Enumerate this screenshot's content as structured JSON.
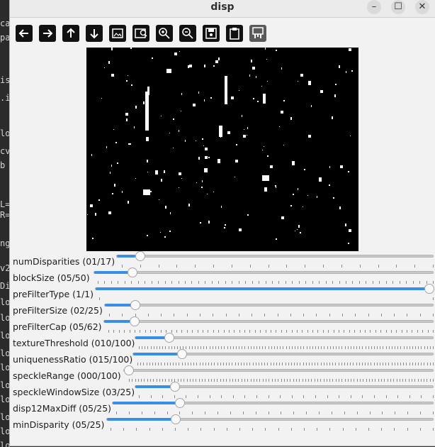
{
  "window": {
    "title": "disp",
    "minimize_glyph": "–",
    "maximize_glyph": "☐",
    "close_glyph": "✕"
  },
  "background_editor_fragments": [
    "ca",
    "pa",
    "",
    "is",
    ".i",
    "",
    "lo",
    "cv",
    " b",
    "",
    "",
    "L=",
    "R=",
    "",
    "ng",
    "",
    "v2",
    "Di",
    "lo",
    "lo",
    "lo",
    "lo",
    "lo",
    "lo",
    "lo",
    "lo",
    "lo",
    "lo"
  ],
  "toolbar": {
    "buttons": [
      {
        "name": "back-button",
        "icon": "arrow-left-icon"
      },
      {
        "name": "forward-button",
        "icon": "arrow-right-icon"
      },
      {
        "name": "up-button",
        "icon": "arrow-up-icon"
      },
      {
        "name": "down-button",
        "icon": "arrow-down-icon"
      },
      {
        "name": "image-button",
        "icon": "image-icon"
      },
      {
        "name": "image-zoom-button",
        "icon": "image-zoom-icon"
      },
      {
        "name": "zoom-in-button",
        "icon": "zoom-in-icon"
      },
      {
        "name": "zoom-out-button",
        "icon": "zoom-out-icon"
      },
      {
        "name": "save-button",
        "icon": "save-icon"
      },
      {
        "name": "copy-button",
        "icon": "clipboard-icon"
      },
      {
        "name": "properties-button",
        "icon": "properties-icon"
      }
    ]
  },
  "image": {
    "description_icon": "disparity-map-image"
  },
  "sliders": [
    {
      "name": "numDisparities",
      "label": "numDisparities (01/17)",
      "value": 1,
      "max": 17
    },
    {
      "name": "blockSize",
      "label": "blockSize  (05/50)",
      "value": 5,
      "max": 50
    },
    {
      "name": "preFilterType",
      "label": "preFilterType (1/1)",
      "value": 1,
      "max": 1
    },
    {
      "name": "preFilterSize",
      "label": "preFilterSize (02/25)",
      "value": 2,
      "max": 25
    },
    {
      "name": "preFilterCap",
      "label": "preFilterCap (05/62)",
      "value": 5,
      "max": 62
    },
    {
      "name": "textureThreshold",
      "label": "textureThreshold (010/100)",
      "value": 10,
      "max": 100
    },
    {
      "name": "uniquenessRatio",
      "label": "uniquenessRatio (015/100)",
      "value": 15,
      "max": 100
    },
    {
      "name": "speckleRange",
      "label": "speckleRange (000/100)",
      "value": 0,
      "max": 100
    },
    {
      "name": "speckleWindowSize",
      "label": "speckleWindowSize (03/25)",
      "value": 3,
      "max": 25
    },
    {
      "name": "disp12MaxDiff",
      "label": "disp12MaxDiff (05/25)",
      "value": 5,
      "max": 25
    },
    {
      "name": "minDisparity",
      "label": "minDisparity (05/25)",
      "value": 5,
      "max": 25
    }
  ],
  "colors": {
    "accent": "#3a8ee6",
    "image_bg": "#000000",
    "window_bg": "#f2f2f2"
  }
}
